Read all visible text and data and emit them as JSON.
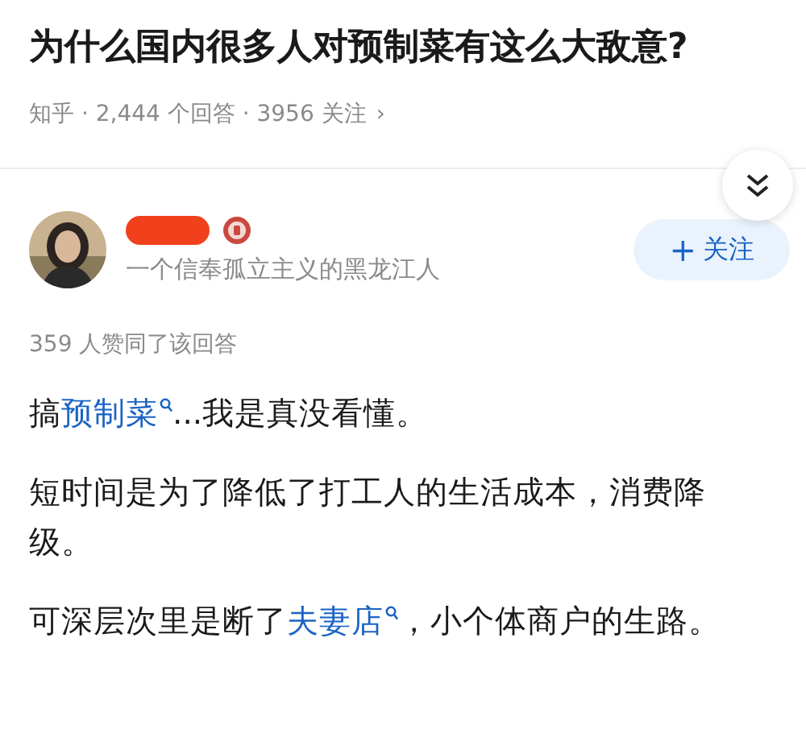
{
  "question": {
    "title": "为什么国内很多人对预制菜有这么大敌意?",
    "meta": "知乎 · 2,444 个回答 · 3956 关注",
    "meta_arrow": "›"
  },
  "author": {
    "name_redacted": true,
    "badge": true,
    "bio": "一个信奉孤立主义的黑龙江人",
    "follow_label": "关注",
    "follow_sign": "+",
    "following": false
  },
  "answer": {
    "likes": "359 人赞同了该回答",
    "paragraphs": [
      [
        {
          "kind": "plain",
          "text": "搞"
        },
        {
          "kind": "link",
          "text": "预制菜"
        },
        {
          "kind": "plain",
          "text": "...我是真没看懂。"
        }
      ],
      [
        {
          "kind": "plain",
          "text": "短时间是为了降低了打工人的生活成本，消费降级。"
        }
      ],
      [
        {
          "kind": "plain",
          "text": "可深层次里是断了"
        },
        {
          "kind": "link",
          "text": "夫妻店"
        },
        {
          "kind": "plain",
          "text": "，小个体商户的生路。"
        }
      ]
    ]
  }
}
